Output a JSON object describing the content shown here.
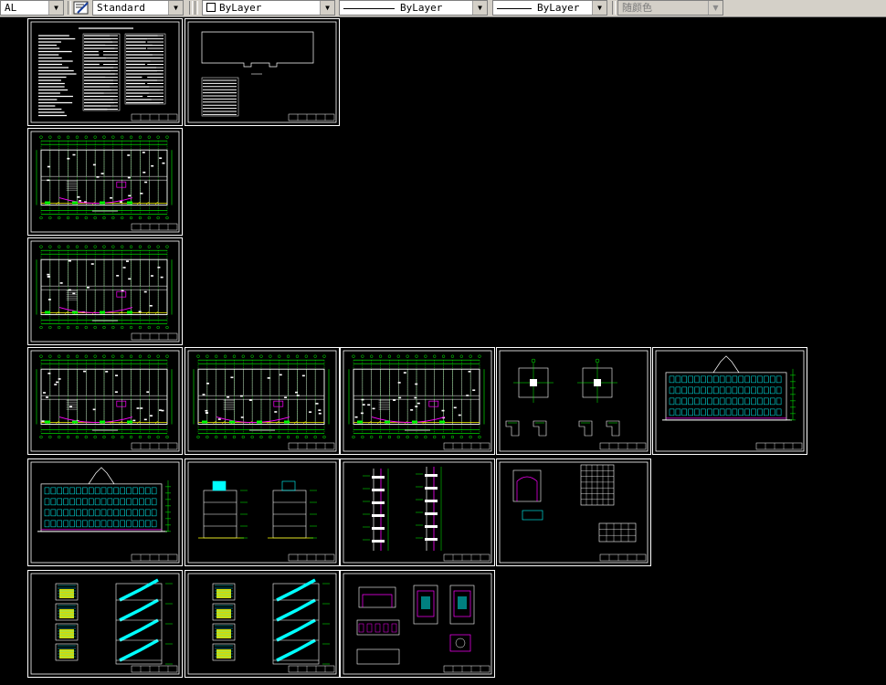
{
  "toolbar": {
    "layer_combo": "AL",
    "text_style": "Standard",
    "color_combo": "ByLayer",
    "linetype_combo": "ByLayer",
    "lineweight_combo": "ByLayer",
    "plot_style_combo": "随颜色"
  },
  "colors": {
    "canvas": "#000000",
    "frame": "#ffffff",
    "green": "#00ff00",
    "yellow": "#ffff00",
    "magenta": "#ff00ff",
    "cyan": "#00ffff"
  },
  "sheets": [
    {
      "kind": "notes"
    },
    {
      "kind": "site"
    },
    {
      "kind": "plan"
    },
    {
      "kind": "plan"
    },
    {
      "kind": "plan"
    },
    {
      "kind": "plan"
    },
    {
      "kind": "plan"
    },
    {
      "kind": "details"
    },
    {
      "kind": "elevation"
    },
    {
      "kind": "elevation"
    },
    {
      "kind": "section"
    },
    {
      "kind": "wallsection"
    },
    {
      "kind": "windows"
    },
    {
      "kind": "stairs"
    },
    {
      "kind": "stairs"
    },
    {
      "kind": "nodes"
    }
  ]
}
